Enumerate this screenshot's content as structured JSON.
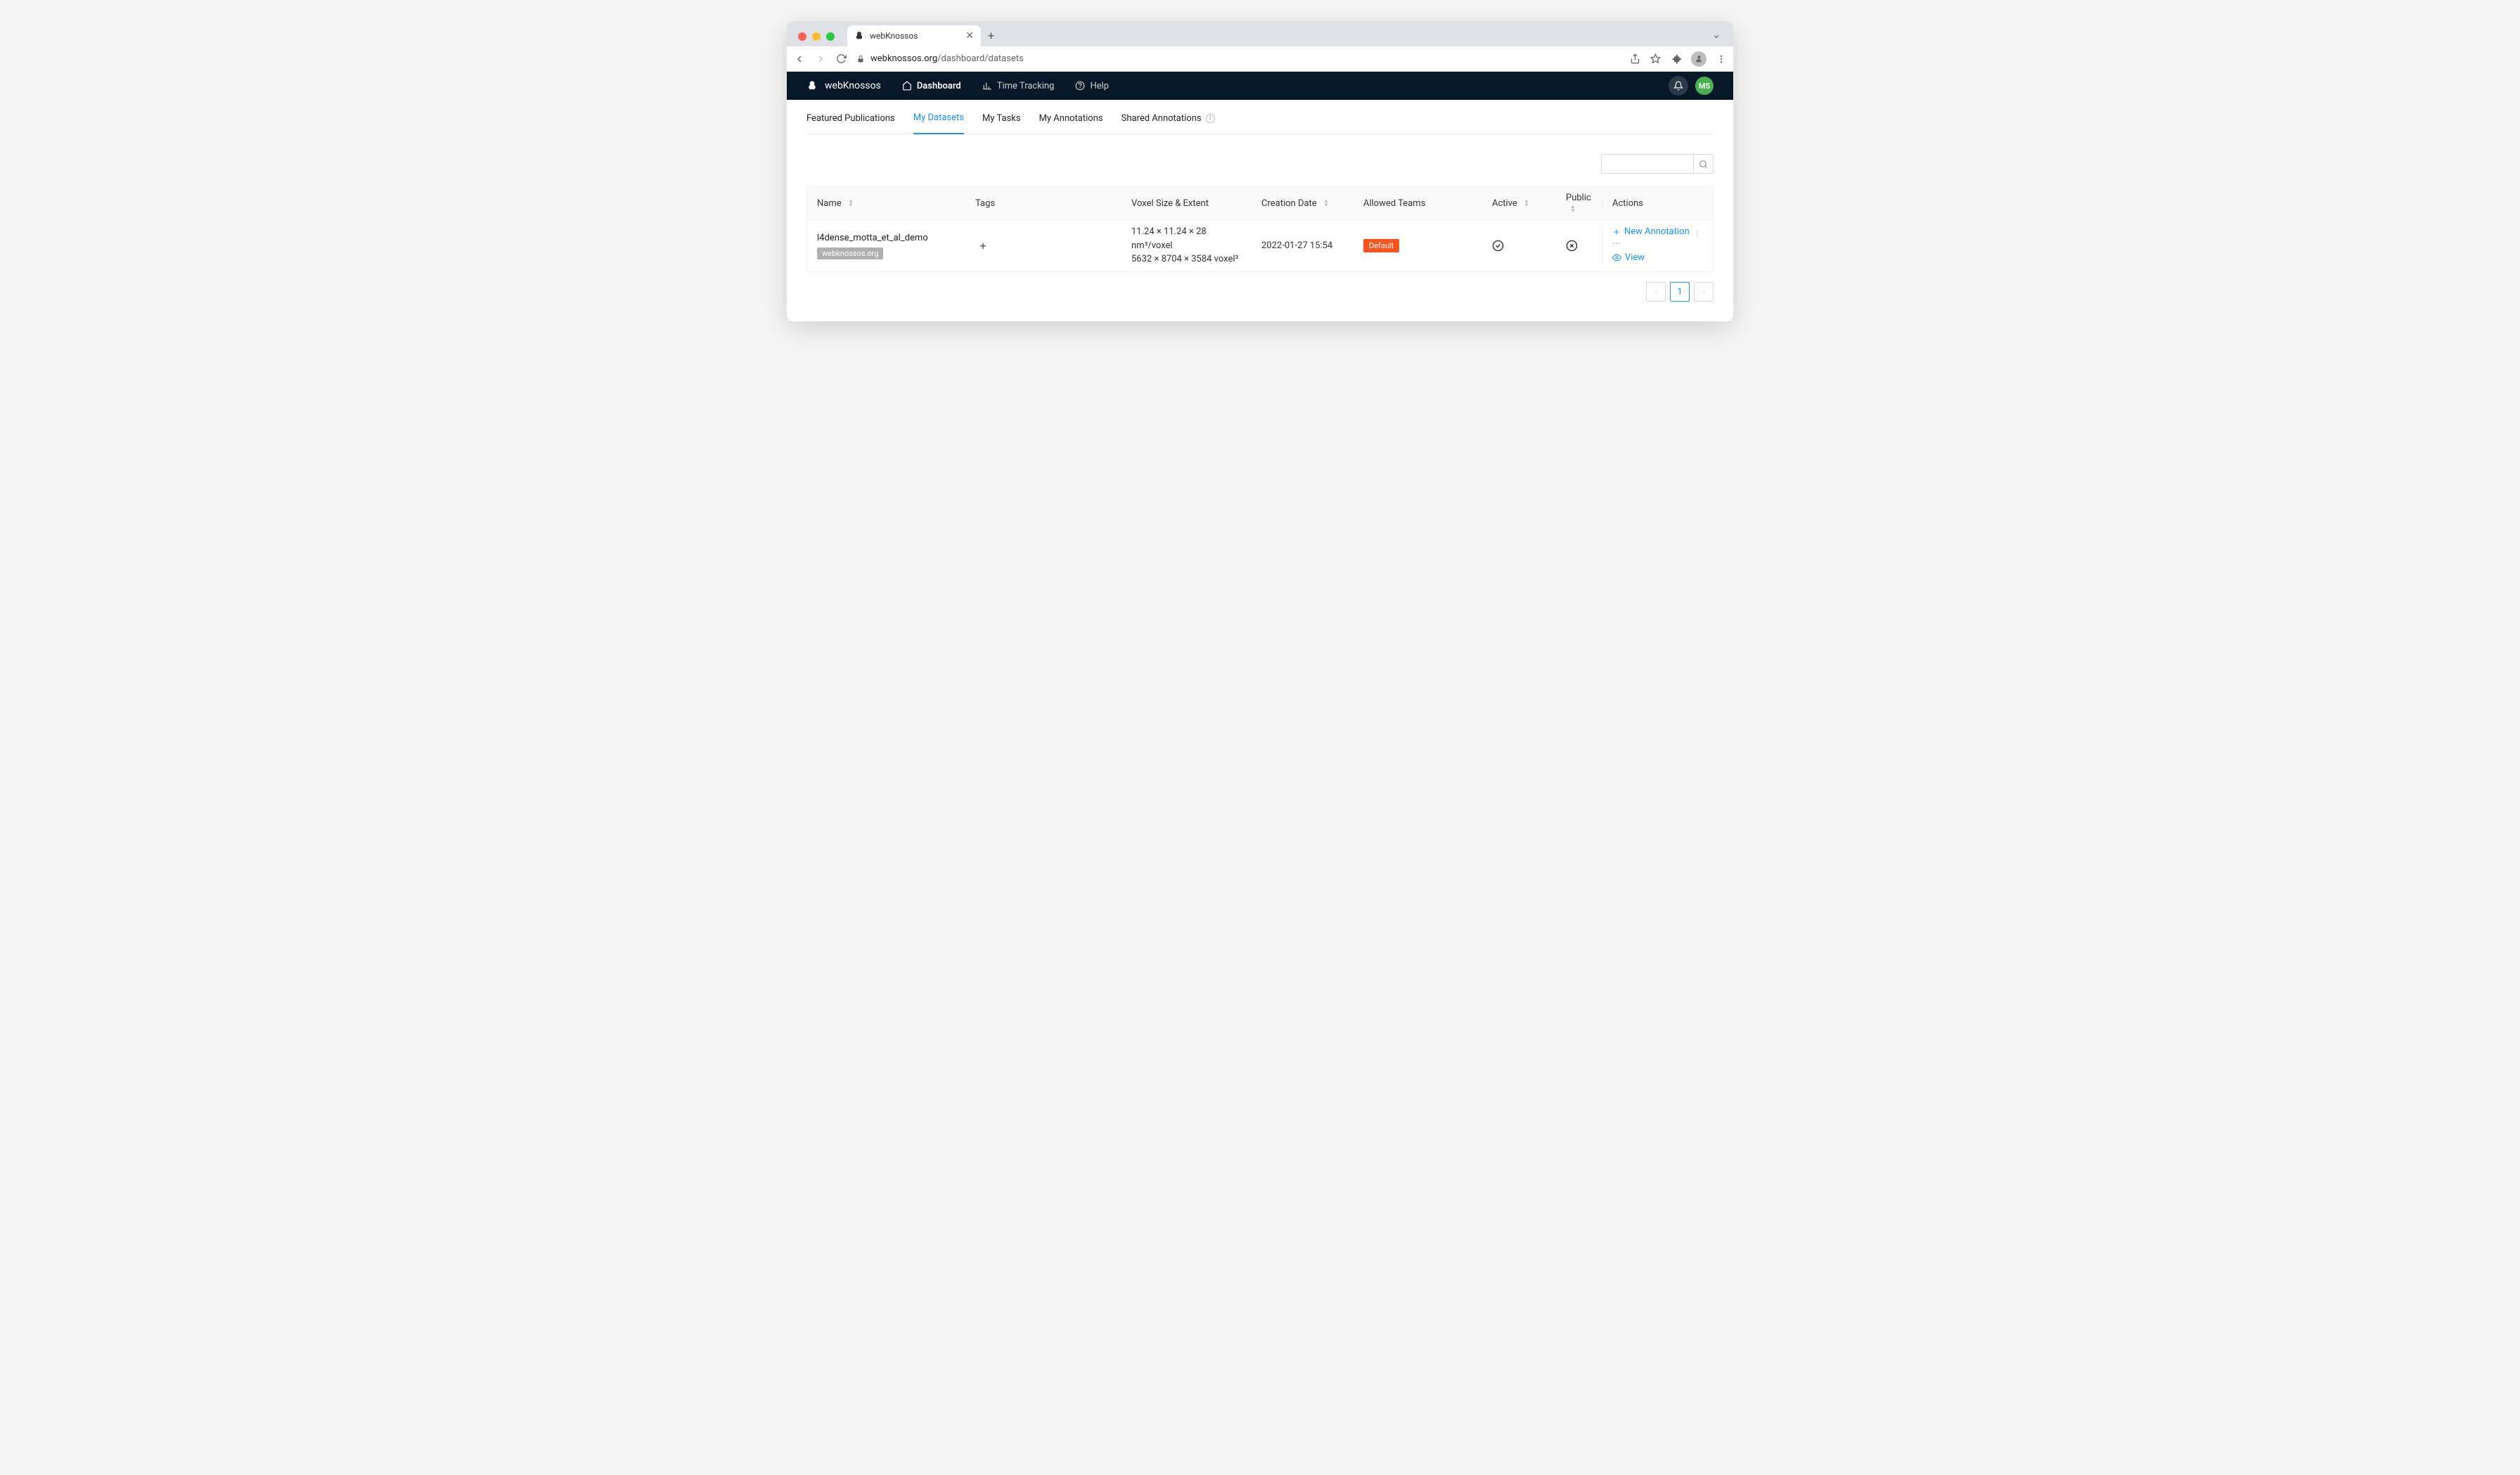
{
  "browser": {
    "tab_title": "webKnossos",
    "url_host": "webknossos.org",
    "url_path": "/dashboard/datasets"
  },
  "header": {
    "brand": "webKnossos",
    "nav": {
      "dashboard": "Dashboard",
      "time_tracking": "Time Tracking",
      "help": "Help"
    },
    "avatar_initials": "MS"
  },
  "subtabs": {
    "featured": "Featured Publications",
    "my_datasets": "My Datasets",
    "my_tasks": "My Tasks",
    "my_annotations": "My Annotations",
    "shared_annotations": "Shared Annotations"
  },
  "table": {
    "columns": {
      "name": "Name",
      "tags": "Tags",
      "voxel": "Voxel Size & Extent",
      "creation": "Creation Date",
      "teams": "Allowed Teams",
      "active": "Active",
      "public": "Public",
      "actions": "Actions"
    },
    "rows": [
      {
        "name": "l4dense_motta_et_al_demo",
        "org": "webknossos.org",
        "voxel_line1": "11.24 × 11.24 × 28 nm³/voxel",
        "voxel_line2": "5632 × 8704 × 3584 voxel³",
        "creation": "2022-01-27 15:54",
        "team": "Default",
        "active": true,
        "public": false
      }
    ],
    "actions": {
      "new_annotation": "New Annotation",
      "view": "View"
    }
  },
  "pagination": {
    "current": "1"
  }
}
